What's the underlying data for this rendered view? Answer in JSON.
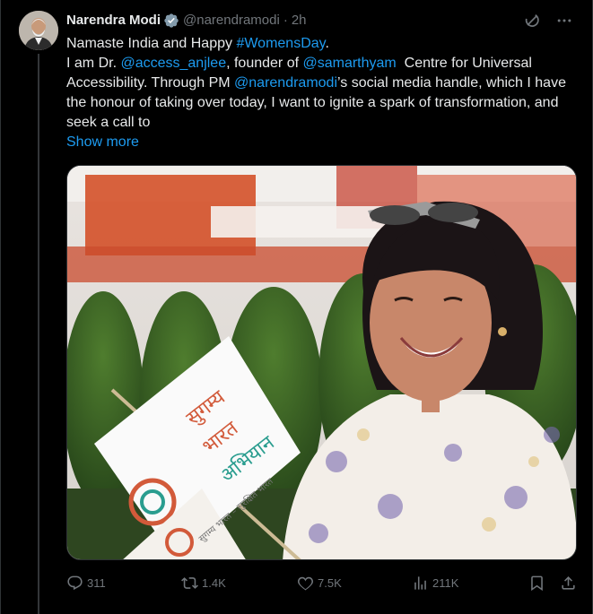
{
  "tweet": {
    "author_name": "Narendra Modi",
    "handle": "@narendramodi",
    "separator": "·",
    "time": "2h",
    "line1_prefix": "Namaste India and Happy ",
    "line1_hashtag": "#WomensDay",
    "line1_suffix": ".",
    "line2_a": "I am Dr. ",
    "line2_mention1": "@access_anjlee",
    "line2_b": ", founder of ",
    "line2_mention2": "@samarthyam",
    "line2_c": "  Centre for Universal Accessibility. Through PM ",
    "line2_mention3": "@narendramodi",
    "line2_d": "’s social media handle, which I have the honour of taking over today, I want to ignite a spark of transformation, and seek a call to",
    "show_more": "Show more",
    "flag_text_1": "सुगम्य",
    "flag_text_2": "भारत",
    "flag_text_3": "अभियान",
    "flag_small_text": "सुगम्य भारत – सुरक्षित भारत"
  },
  "actions": {
    "replies": "311",
    "reposts": "1.4K",
    "likes": "7.5K",
    "views": "211K"
  },
  "colors": {
    "accent": "#1d9bf0",
    "muted": "#71767b",
    "text": "#e7e9ea",
    "background": "#000000"
  }
}
